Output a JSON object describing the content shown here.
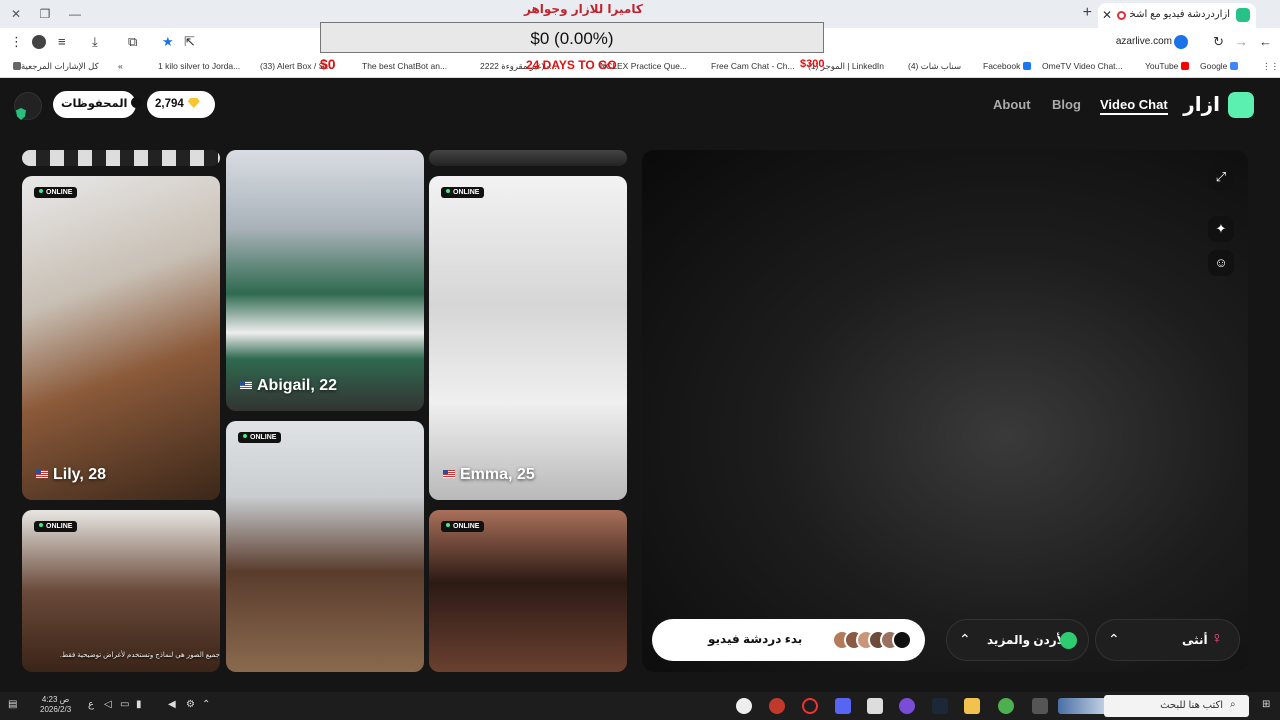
{
  "browser": {
    "tab_title": "أزاردردشة فيديو مع أشخاص",
    "url": "azarlive.com",
    "bookmarks": [
      {
        "label": "Google",
        "color": "#4285f4"
      },
      {
        "label": "YouTube",
        "color": "#ff0000"
      },
      {
        "label": "OmeTV Video Chat...",
        "color": "#ef6c33"
      },
      {
        "label": "Facebook",
        "color": "#1877f2"
      },
      {
        "label": "(4) سناب شات",
        "color": "#f7d600"
      },
      {
        "label": "(1) الموجز | LinkedIn",
        "color": "#0a66c2"
      },
      {
        "label": "Free Cam Chat - Ch...",
        "color": "#999999"
      },
      {
        "label": "NCLEX Practice Que...",
        "color": "#9b59b6"
      },
      {
        "label": "2222 غير مقروءة) -...",
        "color": "#6c4"
      },
      {
        "label": "The best ChatBot an...",
        "color": "#222222"
      },
      {
        "label": "(33) Alert Box / St...",
        "color": "#555555"
      },
      {
        "label": "1 kilo silver to Jorda...",
        "color": "#444444"
      },
      {
        "label": "كل الإشارات المرجعية",
        "color": "#666666"
      }
    ]
  },
  "overlay": {
    "title": "كاميرا للازار وجواهر",
    "amount": "$0 (0.00%)",
    "left_amount": "$0",
    "days": "24 DAYS TO GO",
    "right_amount": "$300"
  },
  "nav": {
    "logo": "ازار",
    "items": [
      "Video Chat",
      "Blog",
      "About"
    ],
    "active": "Video Chat"
  },
  "header": {
    "gems": "2,794",
    "saved_label": "المحفوظات"
  },
  "badge_text": "ONLINE",
  "cards": [
    {
      "name": "Lily, 28",
      "online": true
    },
    {
      "name": "Abigail, 22",
      "online": false
    },
    {
      "name": "Emma, 25",
      "online": true
    },
    {
      "name": "",
      "online": true
    },
    {
      "name": "",
      "online": true
    },
    {
      "name": "",
      "online": true
    }
  ],
  "disclaimer": "جميع الصور هي لنماذج وتستخدم لأغراض توضيحية فقط.",
  "controls": {
    "start_label": "بدء دردشة فيديو",
    "country_label": "الأردن والمزيد",
    "gender_label": "أنثى"
  },
  "taskbar": {
    "time": "4:23 ص",
    "date": "2026/2/3",
    "search_placeholder": "اكتب هنا للبحث",
    "lang": "ع"
  },
  "colors": {
    "accent": "#5cf0b0",
    "online_dot": "#3dec8c",
    "female": "#ff4f88",
    "page_bg": "#151515"
  }
}
